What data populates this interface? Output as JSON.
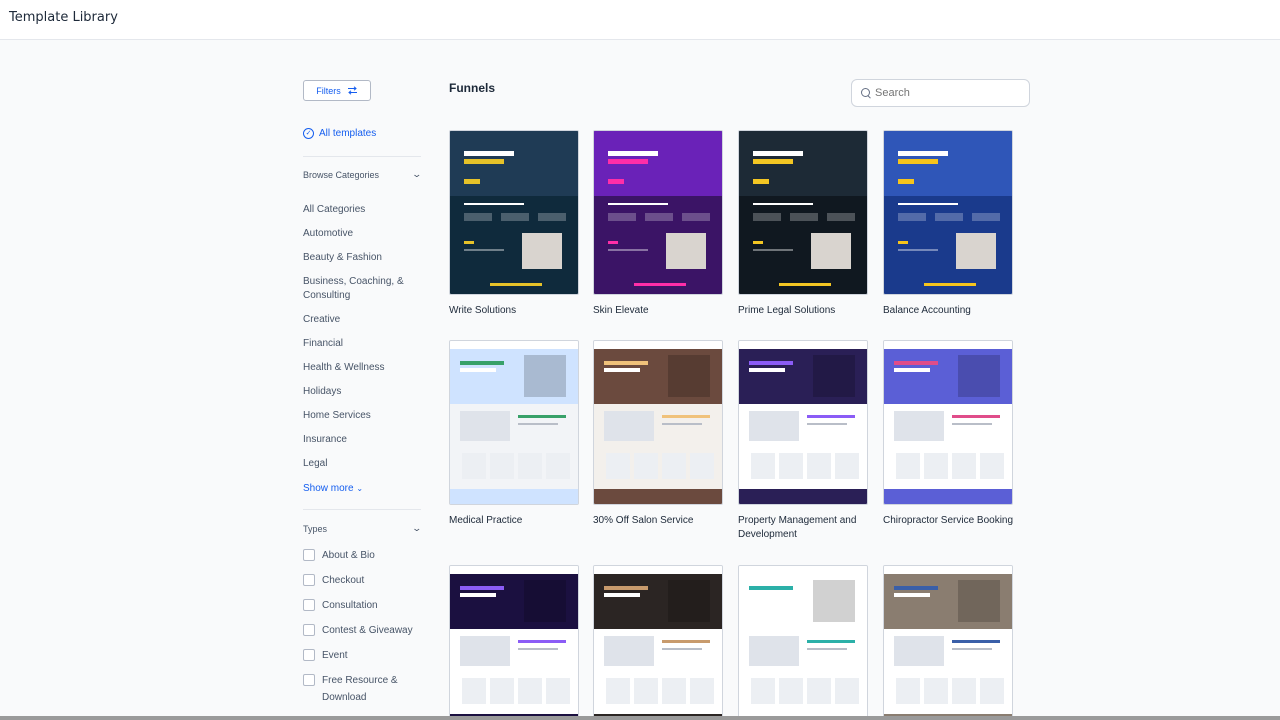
{
  "app": {
    "title": "Template Library"
  },
  "sidebar": {
    "filters_label": "Filters",
    "all_templates": "All templates",
    "browse_title": "Browse Categories",
    "categories": [
      "All Categories",
      "Automotive",
      "Beauty & Fashion",
      "Business, Coaching, & Consulting",
      "Creative",
      "Financial",
      "Health & Wellness",
      "Holidays",
      "Home Services",
      "Insurance",
      "Legal"
    ],
    "show_more": "Show more",
    "types_title": "Types",
    "types": [
      "About & Bio",
      "Checkout",
      "Consultation",
      "Contest & Giveaway",
      "Event",
      "Free Resource & Download"
    ]
  },
  "main": {
    "title": "Funnels",
    "search_placeholder": "Search",
    "cards": [
      {
        "name": "Write Solutions",
        "bg": "#0f2a3c",
        "accent": "#1f3b55",
        "hl": "#e6c229"
      },
      {
        "name": "Skin Elevate",
        "bg": "#3b1466",
        "accent": "#6a22b8",
        "hl": "#ff2ea8"
      },
      {
        "name": "Prime Legal Solutions",
        "bg": "#101820",
        "accent": "#1d2a36",
        "hl": "#f3c623"
      },
      {
        "name": "Balance Accounting",
        "bg": "#1a3a8c",
        "accent": "#2f56b8",
        "hl": "#f6c41c"
      },
      {
        "name": "Medical Practice",
        "bg": "#f2f4f7",
        "accent": "#cfe3ff",
        "hl": "#38a169"
      },
      {
        "name": "30% Off Salon Service",
        "bg": "#f3f0ec",
        "accent": "#6b4a3e",
        "hl": "#f0c27b"
      },
      {
        "name": "Property Management and Development",
        "bg": "#ffffff",
        "accent": "#2a1f56",
        "hl": "#8b5cf6"
      },
      {
        "name": "Chiropractor Service Booking",
        "bg": "#ffffff",
        "accent": "#5b5fd6",
        "hl": "#e04d8a"
      },
      {
        "name": "",
        "bg": "#ffffff",
        "accent": "#1b1040",
        "hl": "#8b5cf6"
      },
      {
        "name": "",
        "bg": "#ffffff",
        "accent": "#2b2523",
        "hl": "#c89b6d"
      },
      {
        "name": "",
        "bg": "#ffffff",
        "accent": "#ffffff",
        "hl": "#2bb0a8"
      },
      {
        "name": "",
        "bg": "#ffffff",
        "accent": "#8a7d70",
        "hl": "#3a5fa8"
      }
    ]
  }
}
